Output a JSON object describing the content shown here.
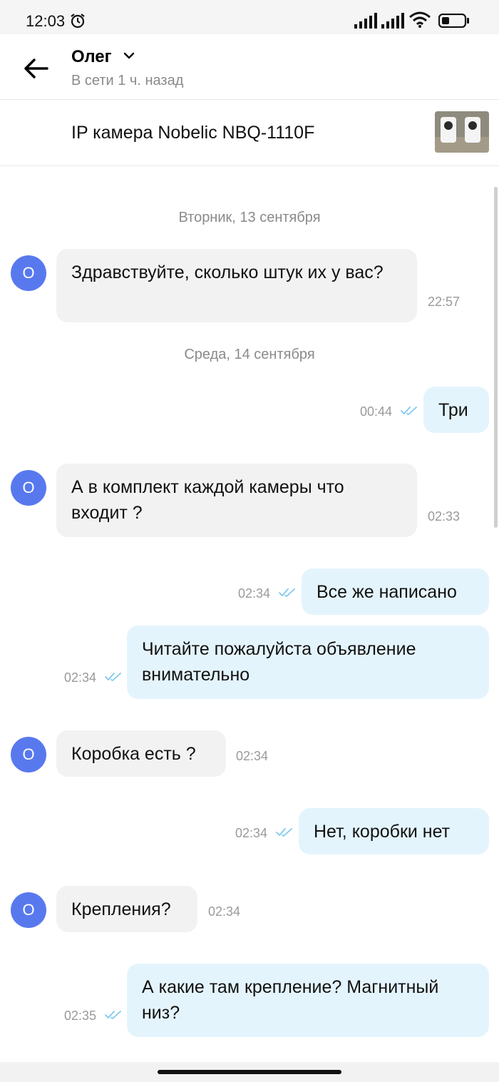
{
  "status_bar": {
    "time": "12:03",
    "icons": [
      "alarm-icon",
      "signal-icon",
      "signal-icon",
      "wifi-icon",
      "battery-icon"
    ]
  },
  "header": {
    "contact_name": "Олег",
    "contact_status": "В сети 1 ч. назад",
    "icons": [
      "back-arrow-icon",
      "chevron-down-icon"
    ]
  },
  "listing": {
    "title": "IP камера Nobelic NBQ-1110F"
  },
  "chat": {
    "avatar_letter": "О",
    "dates": [
      "Вторник, 13 сентября",
      "Среда, 14 сентября"
    ],
    "messages": [
      {
        "direction": "incoming",
        "text": "Здравствуйте, сколько штук их у вас?",
        "time": "22:57"
      },
      {
        "direction": "outgoing",
        "text": "Три",
        "time": "00:44"
      },
      {
        "direction": "incoming",
        "text": "А в комплект каждой камеры что входит ?",
        "time": "02:33"
      },
      {
        "direction": "outgoing",
        "text": "Все же написано",
        "time": "02:34"
      },
      {
        "direction": "outgoing",
        "text": "Читайте пожалуйста объявление внимательно",
        "time": "02:34"
      },
      {
        "direction": "incoming",
        "text": "Коробка есть ?",
        "time": "02:34"
      },
      {
        "direction": "outgoing",
        "text": "Нет, коробки нет",
        "time": "02:34"
      },
      {
        "direction": "incoming",
        "text": "Крепления?",
        "time": "02:34"
      },
      {
        "direction": "outgoing",
        "text": "А какие там крепление? Магнитный низ?",
        "time": "02:35"
      }
    ]
  },
  "colors": {
    "avatar": "#5879ee",
    "incoming_bubble": "#f2f2f2",
    "outgoing_bubble": "#e4f4fd",
    "read_ticks": "#7fc8f0"
  }
}
